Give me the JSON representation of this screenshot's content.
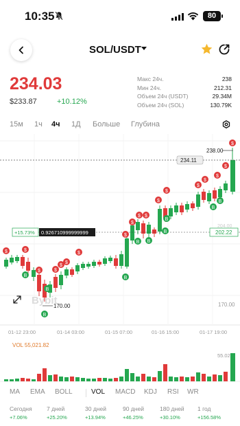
{
  "status_bar": {
    "time": "10:35",
    "battery": "80"
  },
  "nav": {
    "title": "SOL/USDT"
  },
  "price": {
    "last": "234.03",
    "usd": "$233.87",
    "change": "+10.12%"
  },
  "stats": [
    {
      "label": "Макс 24ч.",
      "value": "238"
    },
    {
      "label": "Мин 24ч.",
      "value": "212.31"
    },
    {
      "label": "Объем 24ч (USDT)",
      "value": "29.34M"
    },
    {
      "label": "Объем 24ч (SOL)",
      "value": "130.79K"
    }
  ],
  "timeframes": [
    "15м",
    "1ч",
    "4ч",
    "1Д",
    "Больше",
    "Глубина"
  ],
  "active_timeframe": "4ч",
  "chart": {
    "max_label": "238.00",
    "current_price_tag": "234.11",
    "crosshair_pct": "+15.73%",
    "crosshair_value": "0.926710999999999",
    "right_price_tag": "202.22",
    "min_label": "170.00",
    "axis_low": "170.00",
    "axis_mid_hidden": "204.00",
    "watermark": "Bybit",
    "x_labels": [
      "01-12 23:00",
      "01-14 03:00",
      "01-15 07:00",
      "01-16 15:00",
      "01-17 19:00"
    ],
    "colors": {
      "up": "#25a750",
      "down": "#e03a3a",
      "marker_s": "#e03a3a",
      "marker_b": "#25a750"
    }
  },
  "volume": {
    "label": "VOL 55,021.82",
    "axis_label": "55.02K"
  },
  "indicators": [
    "MA",
    "EMA",
    "BOLL",
    "VOL",
    "MACD",
    "KDJ",
    "RSI",
    "WR"
  ],
  "active_indicator": "VOL",
  "performance": [
    {
      "label": "Сегодня",
      "value": "+7.06%"
    },
    {
      "label": "7 дней",
      "value": "+25.20%"
    },
    {
      "label": "30 дней",
      "value": "+13.94%"
    },
    {
      "label": "90 дней",
      "value": "+46.25%"
    },
    {
      "label": "180 дней",
      "value": "+30.10%"
    },
    {
      "label": "1 год",
      "value": "+156.58%"
    }
  ]
}
